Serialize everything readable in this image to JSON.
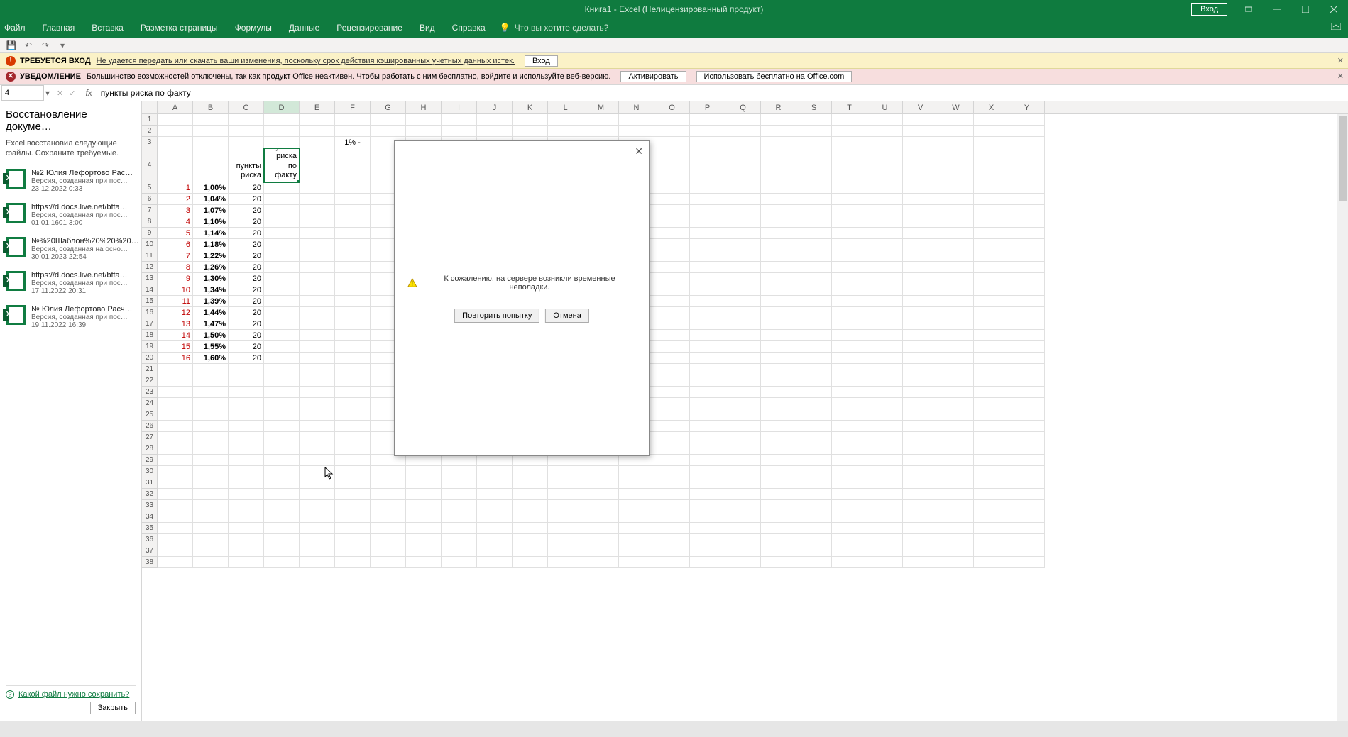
{
  "title": "Книга1 - Excel (Нелицензированный продукт)",
  "titlebar": {
    "login": "Вход"
  },
  "ribbon": {
    "tabs": [
      "Файл",
      "Главная",
      "Вставка",
      "Разметка страницы",
      "Формулы",
      "Данные",
      "Рецензирование",
      "Вид",
      "Справка"
    ],
    "search": "Что вы хотите сделать?"
  },
  "banners": {
    "login": {
      "title": "ТРЕБУЕТСЯ ВХОД",
      "text": "Не удается передать или скачать ваши изменения, поскольку срок действия кэшированных учетных данных истек.",
      "btn": "Вход"
    },
    "notice": {
      "title": "УВЕДОМЛЕНИЕ",
      "text": "Большинство возможностей отключены, так как продукт Office неактивен. Чтобы работать с ним бесплатно, войдите и используйте веб-версию.",
      "btn1": "Активировать",
      "btn2": "Использовать бесплатно на Office.com"
    }
  },
  "namebox": "4",
  "formula": "пункты риска по факту",
  "columns": [
    "A",
    "B",
    "C",
    "D",
    "E",
    "F",
    "G",
    "H",
    "I",
    "J",
    "K",
    "L",
    "M",
    "N",
    "O",
    "P",
    "Q",
    "R",
    "S",
    "T",
    "U",
    "V",
    "W",
    "X",
    "Y"
  ],
  "recovery": {
    "title": "Восстановление докуме…",
    "sub": "Excel восстановил следующие файлы. Сохраните требуемые.",
    "items": [
      {
        "name": "№2  Юлия Лефортово  Рас…",
        "sub": "Версия, созданная при пос…",
        "date": "23.12.2022 0:33"
      },
      {
        "name": "https://d.docs.live.net/bffa…",
        "sub": "Версия, созданная при пос…",
        "date": "01.01.1601 3:00"
      },
      {
        "name": "№%20Шаблон%20%20%20…",
        "sub": "Версия, созданная на осно…",
        "date": "30.01.2023 22:54"
      },
      {
        "name": "https://d.docs.live.net/bffa…",
        "sub": "Версия, созданная при пос…",
        "date": "17.11.2022 20:31"
      },
      {
        "name": "№ Юлия Лефортово  Расч…",
        "sub": "Версия, созданная при пос…",
        "date": "19.11.2022 16:39"
      }
    ],
    "footer_link": "Какой файл нужно сохранить?",
    "close": "Закрыть"
  },
  "headers": {
    "c4": "пункты риска",
    "d4": "пункты риска по факту",
    "f3": "1% - 30%"
  },
  "rows": [
    {
      "n": 5,
      "a": "1",
      "b": "1,00%",
      "c": "20"
    },
    {
      "n": 6,
      "a": "2",
      "b": "1,04%",
      "c": "20"
    },
    {
      "n": 7,
      "a": "3",
      "b": "1,07%",
      "c": "20"
    },
    {
      "n": 8,
      "a": "4",
      "b": "1,10%",
      "c": "20"
    },
    {
      "n": 9,
      "a": "5",
      "b": "1,14%",
      "c": "20"
    },
    {
      "n": 10,
      "a": "6",
      "b": "1,18%",
      "c": "20"
    },
    {
      "n": 11,
      "a": "7",
      "b": "1,22%",
      "c": "20"
    },
    {
      "n": 12,
      "a": "8",
      "b": "1,26%",
      "c": "20"
    },
    {
      "n": 13,
      "a": "9",
      "b": "1,30%",
      "c": "20"
    },
    {
      "n": 14,
      "a": "10",
      "b": "1,34%",
      "c": "20"
    },
    {
      "n": 15,
      "a": "11",
      "b": "1,39%",
      "c": "20"
    },
    {
      "n": 16,
      "a": "12",
      "b": "1,44%",
      "c": "20"
    },
    {
      "n": 17,
      "a": "13",
      "b": "1,47%",
      "c": "20"
    },
    {
      "n": 18,
      "a": "14",
      "b": "1,50%",
      "c": "20"
    },
    {
      "n": 19,
      "a": "15",
      "b": "1,55%",
      "c": "20"
    },
    {
      "n": 20,
      "a": "16",
      "b": "1,60%",
      "c": "20"
    }
  ],
  "empty_rows": [
    21,
    22,
    23,
    24,
    25,
    26,
    27,
    28,
    29,
    30,
    31,
    32,
    33,
    34,
    35,
    36,
    37,
    38
  ],
  "dialog": {
    "msg": "К сожалению, на сервере возникли временные неполадки.",
    "retry": "Повторить попытку",
    "cancel": "Отмена"
  }
}
